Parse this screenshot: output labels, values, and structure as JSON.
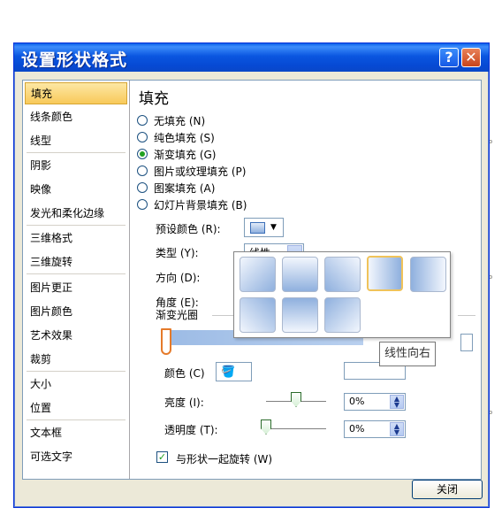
{
  "window": {
    "title": "设置形状格式",
    "help_glyph": "?",
    "close_glyph": "✕"
  },
  "sidebar": {
    "items": [
      {
        "label": "填充",
        "active": true
      },
      {
        "label": "线条颜色"
      },
      {
        "label": "线型"
      },
      {
        "label": "阴影"
      },
      {
        "label": "映像"
      },
      {
        "label": "发光和柔化边缘"
      },
      {
        "label": "三维格式"
      },
      {
        "label": "三维旋转"
      },
      {
        "label": "图片更正"
      },
      {
        "label": "图片颜色"
      },
      {
        "label": "艺术效果"
      },
      {
        "label": "裁剪"
      },
      {
        "label": "大小"
      },
      {
        "label": "位置"
      },
      {
        "label": "文本框"
      },
      {
        "label": "可选文字"
      }
    ]
  },
  "fill": {
    "section_title": "填充",
    "options": [
      {
        "label": "无填充 (N)",
        "checked": false
      },
      {
        "label": "纯色填充 (S)",
        "checked": false
      },
      {
        "label": "渐变填充 (G)",
        "checked": true
      },
      {
        "label": "图片或纹理填充 (P)",
        "checked": false
      },
      {
        "label": "图案填充 (A)",
        "checked": false
      },
      {
        "label": "幻灯片背景填充 (B)",
        "checked": false
      }
    ],
    "preset_label": "预设颜色 (R):",
    "type_label": "类型 (Y):",
    "type_value": "线性",
    "direction_label": "方向 (D):",
    "angle_label": "角度 (E):",
    "stops_label": "渐变光圈",
    "color_label": "颜色 (C)",
    "brightness_label": "亮度 (I):",
    "brightness_value": "0%",
    "brightness_level": 0.5,
    "transparency_label": "透明度 (T):",
    "transparency_value": "0%",
    "transparency_level": 0,
    "rotate_label": "与形状一起旋转 (W)",
    "rotate_checked": true,
    "check_glyph": "✓"
  },
  "direction_popup": {
    "tiles": 8,
    "selected_index": 3,
    "tooltip": "线性向右"
  },
  "icons": {
    "dropdown_arrow": "▼",
    "select_arrow": "⌄",
    "spin_up": "▲",
    "spin_down": "▼"
  },
  "buttons": {
    "close_label": "关闭"
  }
}
